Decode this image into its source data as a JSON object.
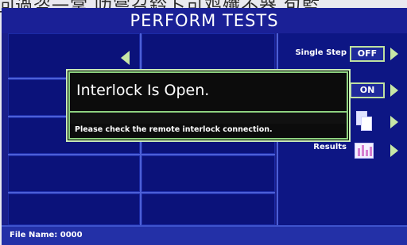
{
  "background_text": "回過咨一掌 叻嘗召鈐卜可鸡殲不器 包監",
  "screen": {
    "title": "PERFORM TESTS"
  },
  "side_panel": {
    "single_step_label": "Single Step",
    "single_step_value": "OFF",
    "row2_value": "ON",
    "results_label": "Results"
  },
  "dialog": {
    "title": "Interlock Is Open.",
    "message": "Please check the remote interlock connection."
  },
  "footer": {
    "file_name_label": "File Name:",
    "file_name_value": "0000"
  },
  "icons": [
    "left-arrow-icon",
    "right-arrow-icon",
    "document-icon",
    "results-chart-icon"
  ],
  "colors": {
    "screen_bg": "#1a1f8a",
    "accent_green": "#8fd281",
    "dialog_bg": "#0c0c0c"
  }
}
